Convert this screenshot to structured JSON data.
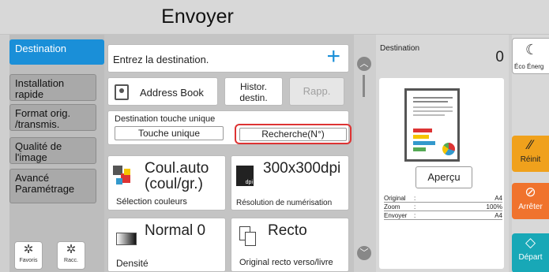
{
  "header": {
    "title": "Envoyer"
  },
  "tabs": [
    {
      "label": "Destination"
    },
    {
      "label": "Installation rapide"
    },
    {
      "label": "Format orig. /transmis."
    },
    {
      "label": "Qualité de l'image"
    },
    {
      "label": "Avancé Paramétrage"
    }
  ],
  "bottom_icons": {
    "favoris": "Favoris",
    "racc": "Racc."
  },
  "destination_input": {
    "placeholder": "Entrez la destination."
  },
  "buttons": {
    "address_book": "Address Book",
    "histor": "Histor. destin.",
    "rapp": "Rapp."
  },
  "one_touch": {
    "label": "Destination touche unique",
    "touche_unique": "Touche unique",
    "recherche": "Recherche(N°)"
  },
  "settings": {
    "color_value": "Coul.auto (coul/gr.)",
    "color_label": "Sélection couleurs",
    "resolution_value": "300x300dpi",
    "resolution_label": "Résolution de numérisation",
    "density_value": "Normal 0",
    "density_label": "Densité",
    "duplex_value": "Recto",
    "duplex_label": "Original recto verso/livre"
  },
  "preview": {
    "destination_label": "Destination",
    "destination_count": "0",
    "apercu": "Aperçu",
    "info": [
      {
        "key": "Original",
        "value": "A4"
      },
      {
        "key": "Zoom",
        "value": "100%"
      },
      {
        "key": "Envoyer",
        "value": "A4"
      }
    ],
    "dpi_icon_text": "dpi"
  },
  "side": {
    "eco": "Éco Énerg",
    "reinit": "Réinit",
    "arreter": "Arrêter",
    "depart": "Départ"
  },
  "colors": {
    "accent": "#1a8fd8",
    "highlight": "#dd3333",
    "reinit": "#f0a11c",
    "stop": "#f0732d",
    "start": "#18a8b7"
  }
}
